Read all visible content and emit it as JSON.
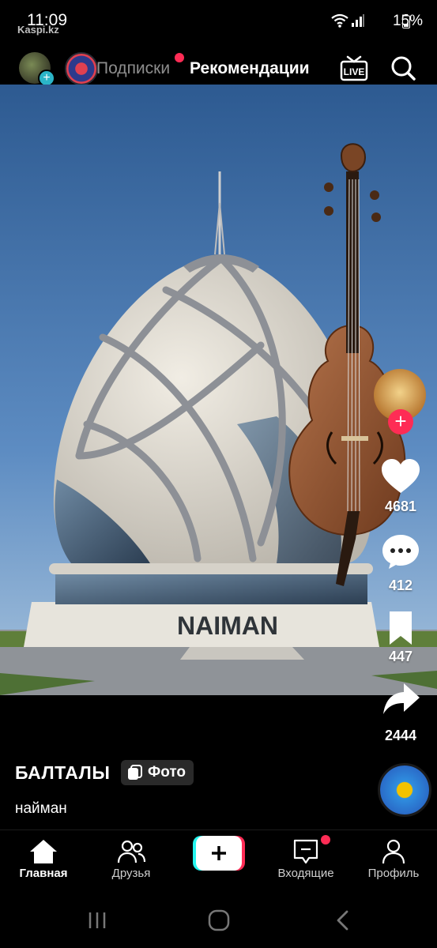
{
  "status_bar": {
    "time": "11:09",
    "watermark": "Kaspi.kz",
    "battery": "15%"
  },
  "top_nav": {
    "following_label": "Подписки",
    "for_you_label": "Рекомендации",
    "live_label": "LIVE"
  },
  "photo": {
    "building_sign": "NAIMAN"
  },
  "actions": {
    "likes": "4681",
    "comments": "412",
    "saves": "447",
    "shares": "2444"
  },
  "post": {
    "author": "БАЛТАЛЫ",
    "badge": "Фото",
    "description": "найман"
  },
  "bottom_nav": {
    "home": "Главная",
    "friends": "Друзья",
    "inbox": "Входящие",
    "profile": "Профиль"
  },
  "colors": {
    "accent": "#fe2c55",
    "create_cyan": "#25f4ee",
    "sky": "#4f7fb8"
  }
}
